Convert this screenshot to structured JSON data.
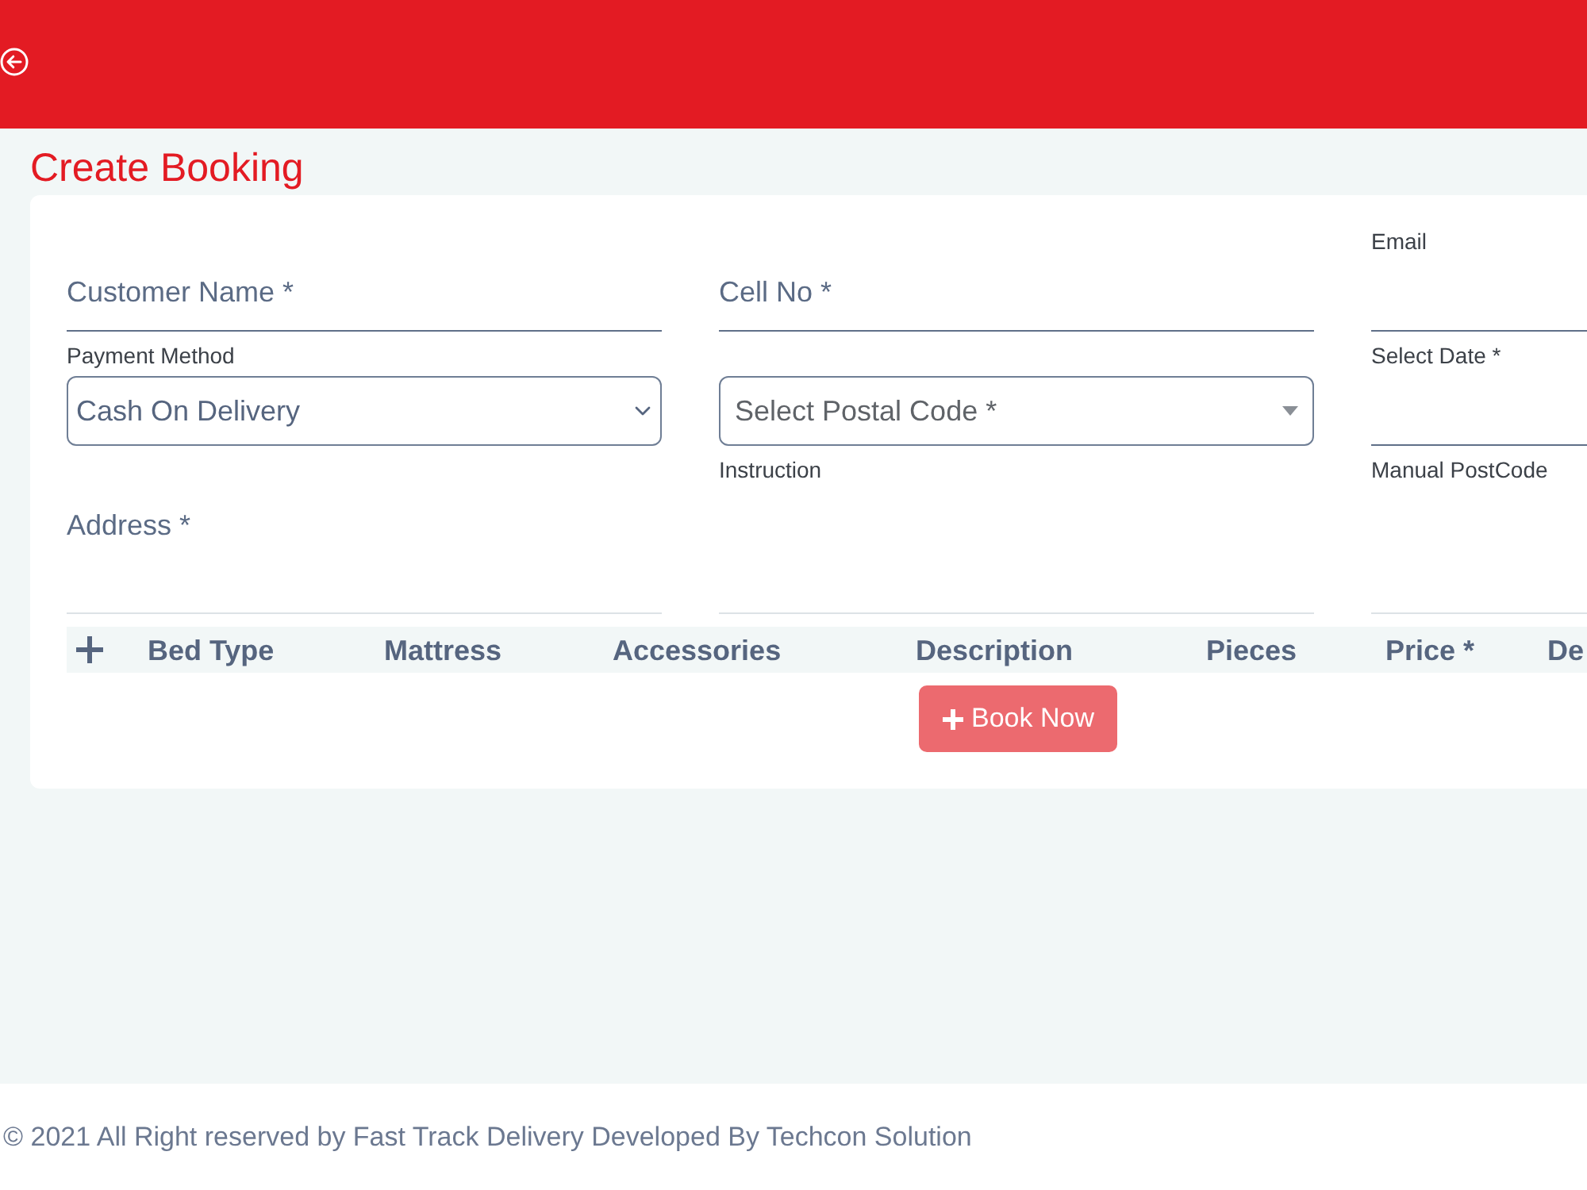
{
  "page_title": "Create Booking",
  "form": {
    "fields": [
      {
        "kind": "text",
        "placeholder": "Customer Name *"
      },
      {
        "kind": "text",
        "placeholder": "Cell No *"
      },
      {
        "kind": "text",
        "label": "Email"
      },
      {
        "kind": "select",
        "label": "Payment Method",
        "value": "Cash On Delivery"
      },
      {
        "kind": "combobox",
        "placeholder": "Select Postal Code *"
      },
      {
        "kind": "text",
        "label": "Select Date *"
      },
      {
        "kind": "textarea",
        "placeholder": "Address *"
      },
      {
        "kind": "textarea",
        "label": "Instruction"
      },
      {
        "kind": "textarea",
        "label": "Manual PostCode"
      }
    ]
  },
  "items_table": {
    "columns": [
      "Bed Type",
      "Mattress",
      "Accessories",
      "Description",
      "Pieces",
      "Price *",
      "De"
    ]
  },
  "book_button": {
    "label": "Book Now",
    "disabled": true
  },
  "footer": {
    "text": "© 2021 All Right reserved by Fast Track Delivery Developed By Techcon Solution"
  }
}
